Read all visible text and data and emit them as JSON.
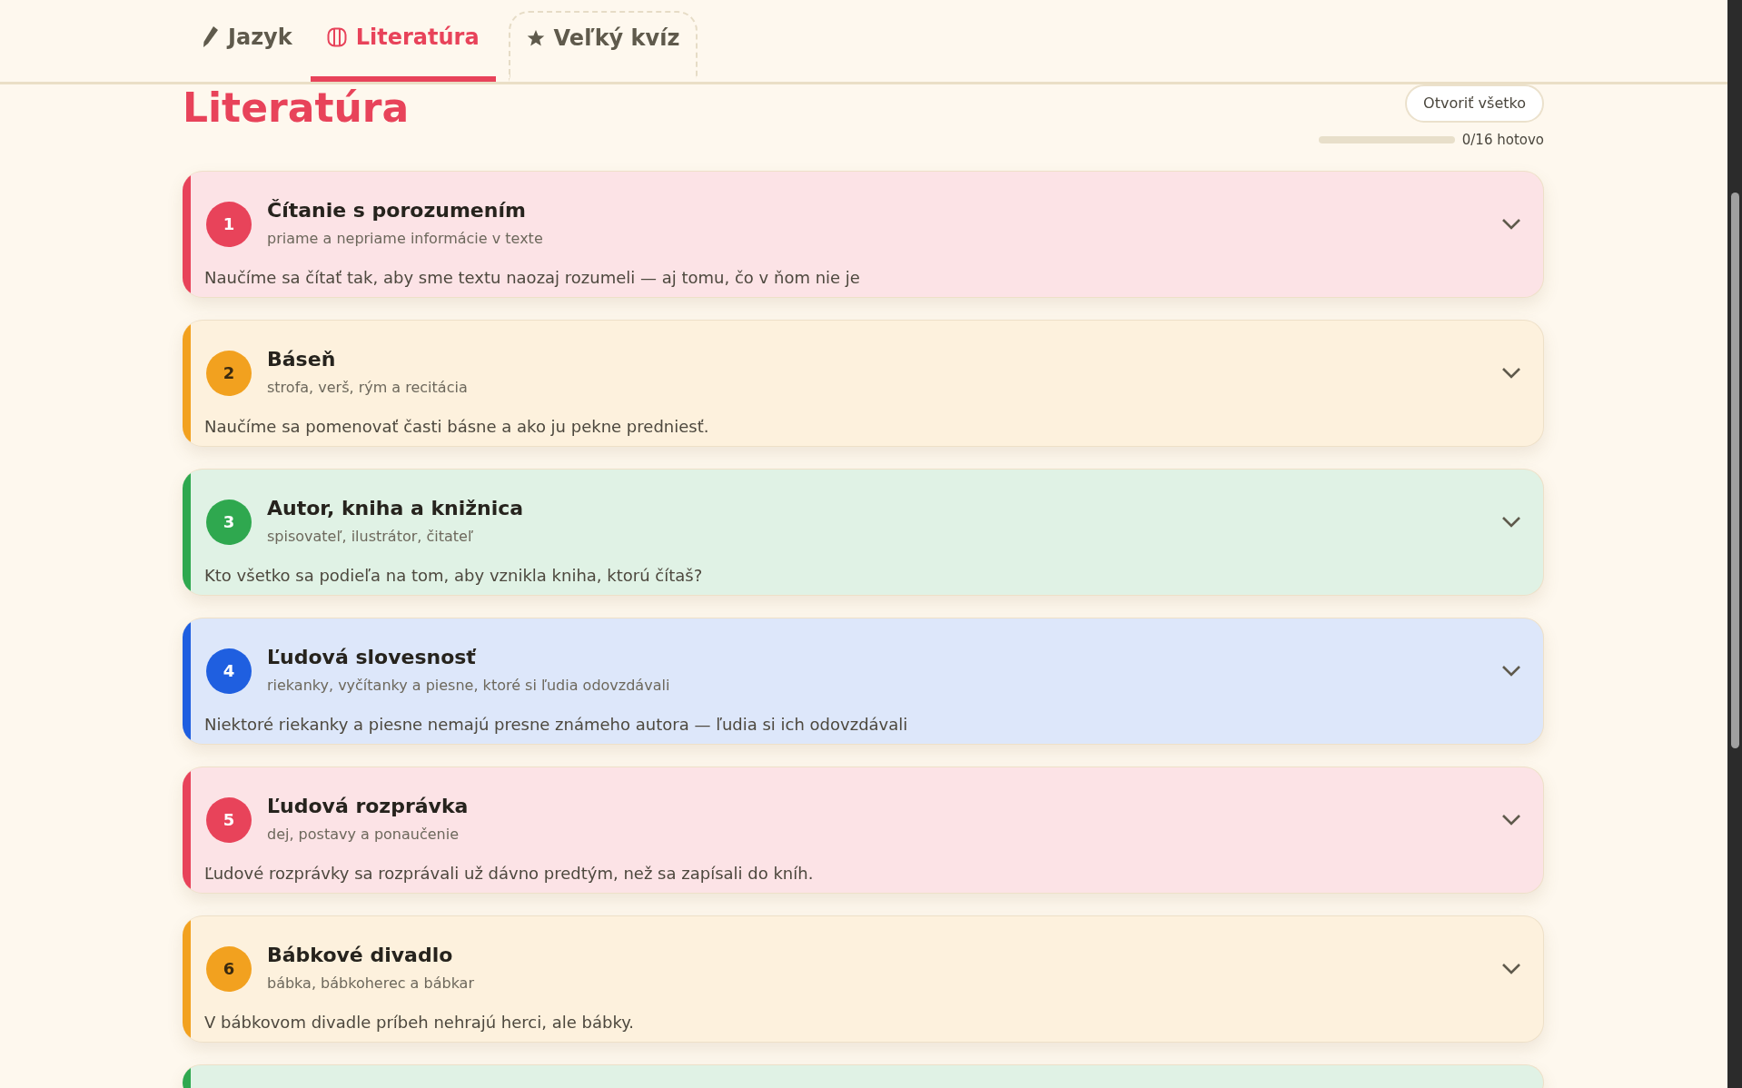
{
  "tabs": [
    {
      "label": "Jazyk",
      "kind": "pencil",
      "selected": false
    },
    {
      "label": "Literatúra",
      "kind": "book",
      "selected": true
    },
    {
      "label": "Veľký kvíz",
      "kind": "star",
      "selected": false
    }
  ],
  "page": {
    "title": "Literatúra",
    "open_all_button": "Otvoriť všetko",
    "progress": {
      "level": 0,
      "reading": "0/16 hotovo"
    }
  },
  "lessons": [
    {
      "number": "1",
      "title": "Čítanie s porozumením",
      "subtitle": "priame a nepriame informácie v texte",
      "description": "Naučíme sa čítať tak, aby sme textu naozaj rozumeli — aj tomu, čo v ňom nie je",
      "color": "#e8435a",
      "expanded": false
    },
    {
      "number": "2",
      "title": "Báseň",
      "subtitle": "strofa, verš, rým a recitácia",
      "description": "Naučíme sa pomenovať časti básne a ako ju pekne predniesť.",
      "color": "#f2a11f",
      "expanded": false
    },
    {
      "number": "3",
      "title": "Autor, kniha a knižnica",
      "subtitle": "spisovateľ, ilustrátor, čitateľ",
      "description": "Kto všetko sa podieľa na tom, aby vznikla kniha, ktorú čítaš?",
      "color": "#2fa84f",
      "expanded": false
    },
    {
      "number": "4",
      "title": "Ľudová slovesnosť",
      "subtitle": "riekanky, vyčítanky a piesne, ktoré si ľudia odovzdávali",
      "description": "Niektoré riekanky a piesne nemajú presne známeho autora — ľudia si ich odovzdávali",
      "color": "#1f5fe0",
      "expanded": false
    },
    {
      "number": "5",
      "title": "Ľudová rozprávka",
      "subtitle": "dej, postavy a ponaučenie",
      "description": "Ľudové rozprávky sa rozprávali už dávno predtým, než sa zapísali do kníh.",
      "color": "#e8435a",
      "expanded": false
    },
    {
      "number": "6",
      "title": "Bábkové divadlo",
      "subtitle": "bábka, bábkoherec a bábkar",
      "description": "V bábkovom divadle príbeh nehrajú herci, ale bábky.",
      "color": "#f2a11f",
      "expanded": false
    },
    {
      "color": "#2fa84f"
    }
  ]
}
